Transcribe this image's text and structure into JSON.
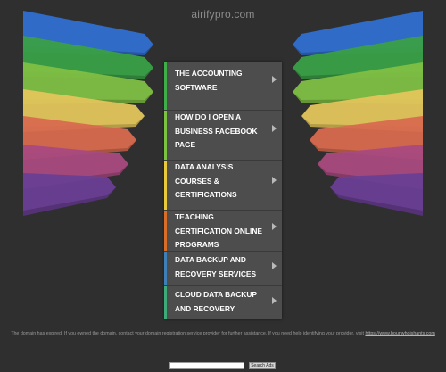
{
  "header": {
    "domain": "airifypro.com"
  },
  "links": [
    {
      "label": "THE ACCOUNTING SOFTWARE",
      "accent": "#3fae49"
    },
    {
      "label": "HOW DO I OPEN A BUSINESS FACEBOOK PAGE",
      "accent": "#7cc242"
    },
    {
      "label": "DATA ANALYSIS COURSES & CERTIFICATIONS",
      "accent": "#e8c93a"
    },
    {
      "label": "TEACHING CERTIFICATION ONLINE PROGRAMS",
      "accent": "#d86d28"
    },
    {
      "label": "DATA BACKUP AND RECOVERY SERVICES",
      "accent": "#3f7fb8"
    },
    {
      "label": "CLOUD DATA BACKUP AND RECOVERY",
      "accent": "#3daa7a"
    }
  ],
  "wing_colors": [
    "#2f6fd0",
    "#3aa047",
    "#7fbf45",
    "#e3c55c",
    "#d86a4f",
    "#a94a80",
    "#6a3f95"
  ],
  "footer": {
    "disclaimer_part1": "The domain has expired. If you owned the domain, contact your domain registration service provider for further assistance. If you need help identifying your provider, visit",
    "disclaimer_link": "https://www.bounwhoishants.com",
    "search_placeholder": "",
    "search_button": "Search Ads"
  }
}
